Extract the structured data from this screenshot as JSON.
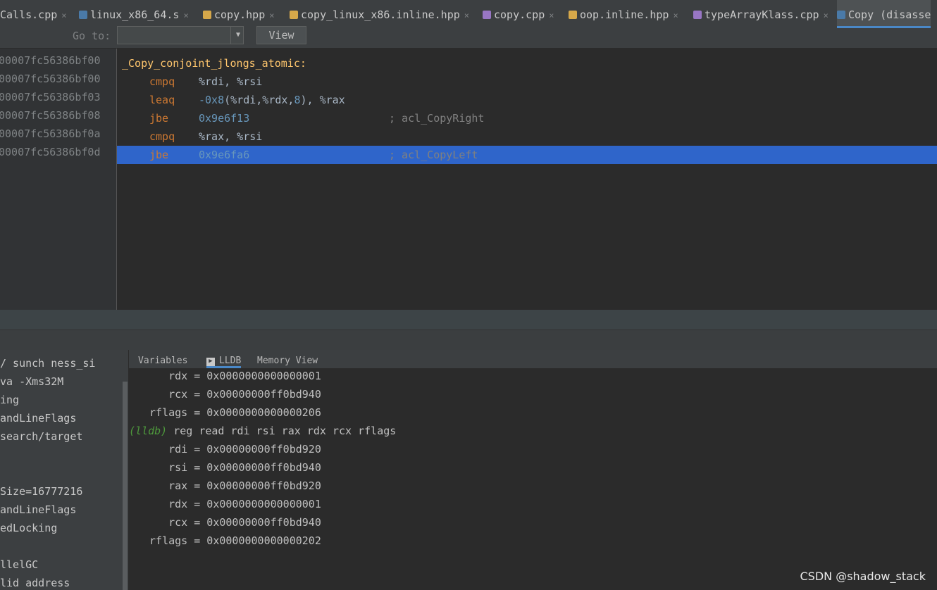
{
  "tabs": [
    {
      "label": "Calls.cpp",
      "close": "×",
      "icon": "none"
    },
    {
      "label": "linux_x86_64.s",
      "close": "×",
      "icon": "asm-file-icon"
    },
    {
      "label": "copy.hpp",
      "close": "×",
      "icon": "header-file-icon"
    },
    {
      "label": "copy_linux_x86.inline.hpp",
      "close": "×",
      "icon": "header-file-icon"
    },
    {
      "label": "copy.cpp",
      "close": "×",
      "icon": "cpp-file-icon"
    },
    {
      "label": "oop.inline.hpp",
      "close": "×",
      "icon": "header-file-icon"
    },
    {
      "label": "typeArrayKlass.cpp",
      "close": "×",
      "icon": "cpp-file-icon"
    },
    {
      "label": "Copy (disasse",
      "close": "",
      "icon": "disasm-file-icon"
    }
  ],
  "goto": {
    "label": "Go to:",
    "value": "",
    "view_button": "View"
  },
  "addresses": [
    "00007fc56386bf00",
    "00007fc56386bf00",
    "00007fc56386bf03",
    "00007fc56386bf08",
    "00007fc56386bf0a",
    "00007fc56386bf0d"
  ],
  "code": {
    "label": "_Copy_conjoint_jlongs_atomic:",
    "lines": [
      {
        "op": "cmpq",
        "args": [
          {
            "t": "%rdi, %rsi",
            "c": "reg"
          }
        ],
        "comment": ""
      },
      {
        "op": "leaq",
        "args": [
          {
            "t": "-0x8",
            "c": "num"
          },
          {
            "t": "(%rdi,%rdx,",
            "c": "reg"
          },
          {
            "t": "8",
            "c": "num"
          },
          {
            "t": "), %rax",
            "c": "reg"
          }
        ],
        "comment": ""
      },
      {
        "op": "jbe",
        "args": [
          {
            "t": "0x9e6f13",
            "c": "num"
          }
        ],
        "comment": "; acl_CopyRight"
      },
      {
        "op": "cmpq",
        "args": [
          {
            "t": "%rax, %rsi",
            "c": "reg"
          }
        ],
        "comment": ""
      },
      {
        "op": "jbe",
        "args": [
          {
            "t": "0x9e6fa6",
            "c": "num"
          }
        ],
        "comment": "; acl_CopyLeft"
      }
    ],
    "selected_line": 4
  },
  "debug_tabs": [
    "Variables",
    "LLDB",
    "Memory View"
  ],
  "active_debug_tab": "LLDB",
  "left_panel_lines": [
    "/ sunch ness_si",
    "va -Xms32M",
    "ing",
    "andLineFlags",
    "search/target",
    "",
    "",
    "Size=16777216",
    "andLineFlags",
    "edLocking",
    "",
    "llelGC",
    "lid address"
  ],
  "console_lines": [
    {
      "text": "    rdx = 0x0000000000000001",
      "prompt": ""
    },
    {
      "text": "    rcx = 0x00000000ff0bd940",
      "prompt": ""
    },
    {
      "text": " rflags = 0x0000000000000206",
      "prompt": ""
    },
    {
      "text": " reg read rdi rsi rax rdx rcx rflags",
      "prompt": "(lldb)"
    },
    {
      "text": "    rdi = 0x00000000ff0bd920",
      "prompt": ""
    },
    {
      "text": "    rsi = 0x00000000ff0bd940",
      "prompt": ""
    },
    {
      "text": "    rax = 0x00000000ff0bd920",
      "prompt": ""
    },
    {
      "text": "    rdx = 0x0000000000000001",
      "prompt": ""
    },
    {
      "text": "    rcx = 0x00000000ff0bd940",
      "prompt": ""
    },
    {
      "text": " rflags = 0x0000000000000202",
      "prompt": ""
    }
  ],
  "watermark": "CSDN @shadow_stack"
}
